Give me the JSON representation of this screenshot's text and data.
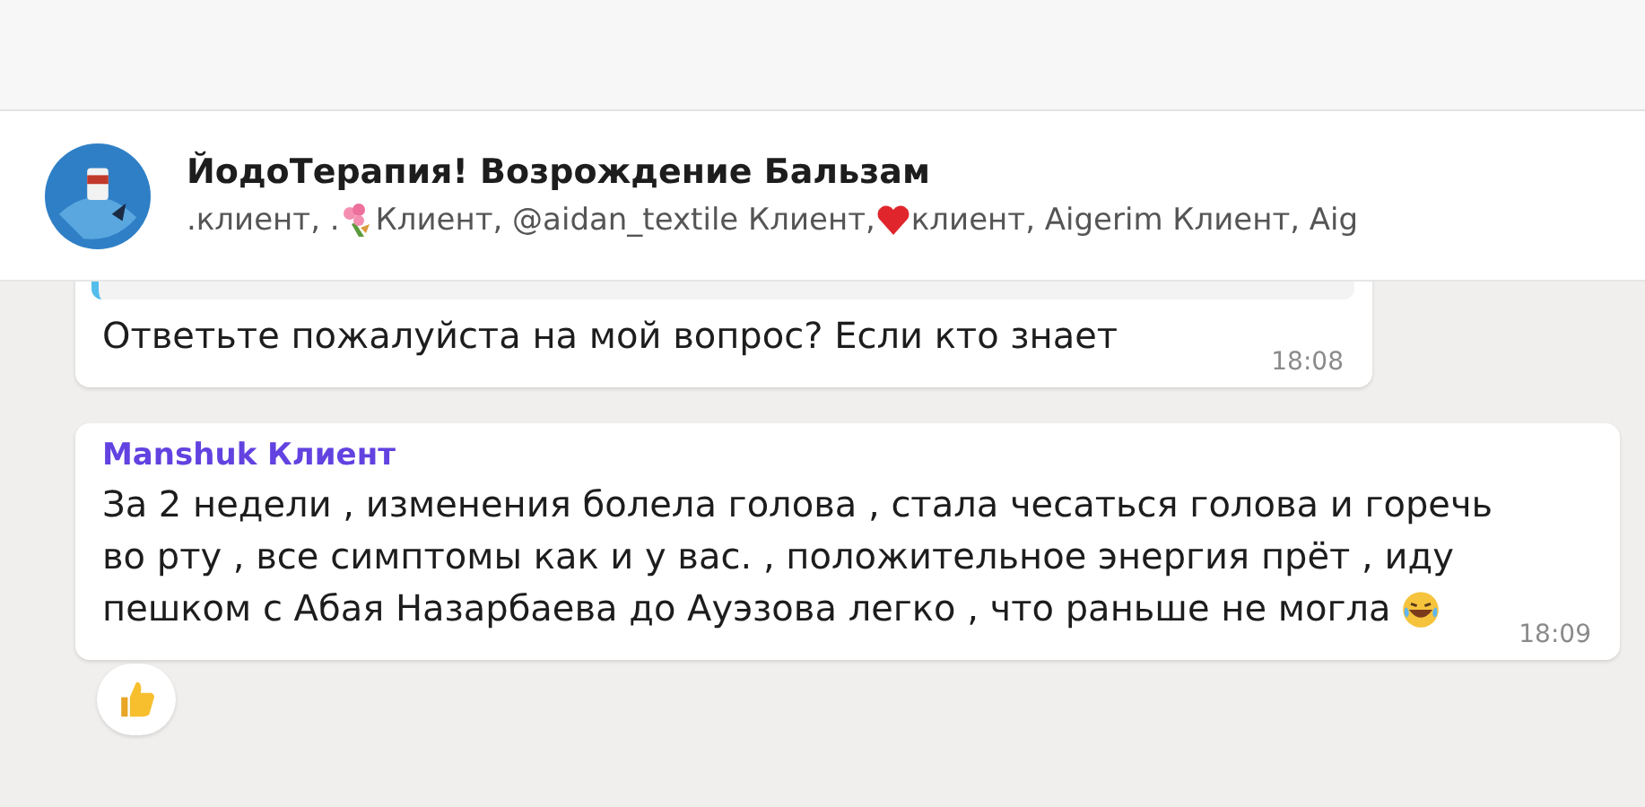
{
  "chat": {
    "title": "ЙодоТерапия! Возрождение Бальзам",
    "subtitle_parts": [
      {
        "kind": "text",
        "text": ".клиент, ."
      },
      {
        "kind": "flower"
      },
      {
        "kind": "text",
        "text": " Клиент, @aidan_textile Клиент, "
      },
      {
        "kind": "heart"
      },
      {
        "kind": "text",
        "text": "клиент, Aigerim Клиент, Aig"
      }
    ]
  },
  "messages": [
    {
      "kind": "reply",
      "lines": [
        [
          {
            "kind": "text",
            "text": "Ответьте пожалуйста на мой вопрос? Если кто знает"
          }
        ]
      ],
      "time": "18:08"
    },
    {
      "kind": "plain",
      "sender": "Manshuk Клиент",
      "lines": [
        [
          {
            "kind": "text",
            "text": "За 2 недели , изменения болела голова , стала чесаться голова и горечь"
          }
        ],
        [
          {
            "kind": "text",
            "text": "во рту , все симптомы как и у вас. , положительное энергия прёт , иду"
          }
        ],
        [
          {
            "kind": "text",
            "text": "пешком с Абая Назарбаева до Ауэзова легко , что раньше не могла"
          },
          {
            "kind": "laugh"
          }
        ]
      ],
      "time": "18:09",
      "reaction": true
    }
  ]
}
